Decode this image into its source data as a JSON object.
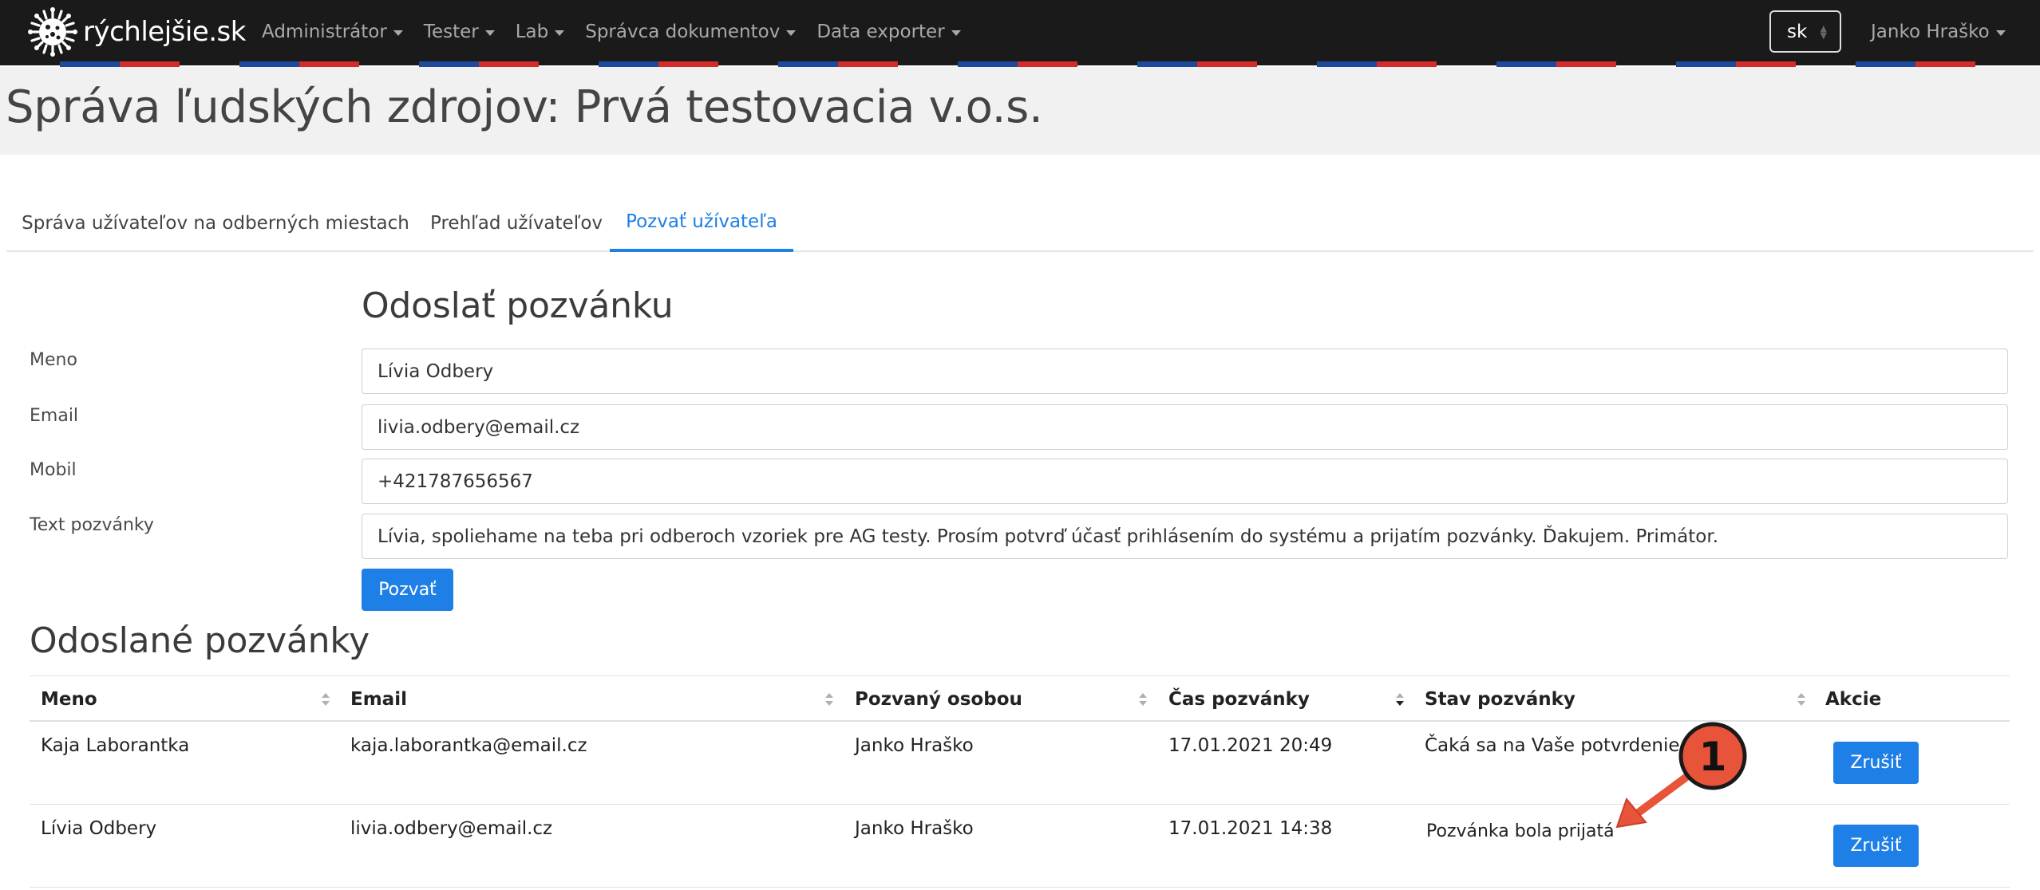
{
  "navbar": {
    "brand": "rýchlejšie.sk",
    "menu": [
      {
        "label": "Administrátor"
      },
      {
        "label": "Tester"
      },
      {
        "label": "Lab"
      },
      {
        "label": "Správca dokumentov"
      },
      {
        "label": "Data exporter"
      }
    ],
    "language": "sk",
    "user": "Janko Hraško"
  },
  "page": {
    "title": "Správa ľudských zdrojov: Prvá testovacia v.o.s."
  },
  "tabs": [
    {
      "label": "Správa užívateľov na odberných miestach",
      "active": false
    },
    {
      "label": "Prehľad užívateľov",
      "active": false
    },
    {
      "label": "Pozvať užívateľa",
      "active": true
    }
  ],
  "form": {
    "heading": "Odoslať pozvánku",
    "fields": {
      "name": {
        "label": "Meno",
        "value": "Lívia Odbery"
      },
      "email": {
        "label": "Email",
        "value": "livia.odbery@email.cz"
      },
      "mobile": {
        "label": "Mobil",
        "value": "+421787656567"
      },
      "text": {
        "label": "Text pozvánky",
        "value": "Lívia, spoliehame na teba pri odberoch vzoriek pre AG testy. Prosím potvrď účasť prihlásením do systému a prijatím pozvánky. Ďakujem. Primátor."
      }
    },
    "submit_label": "Pozvať"
  },
  "sent": {
    "heading": "Odoslané pozvánky",
    "columns": {
      "name": "Meno",
      "email": "Email",
      "invited_by": "Pozvaný osobou",
      "time": "Čas pozvánky",
      "status": "Stav pozvánky",
      "actions": "Akcie"
    },
    "rows": [
      {
        "name": "Kaja Laborantka",
        "email": "kaja.laborantka@email.cz",
        "invited_by": "Janko Hraško",
        "time": "17.01.2021 20:49",
        "status": "Čaká sa na Vaše potvrdenie",
        "action": "Zrušiť"
      },
      {
        "name": "Lívia Odbery",
        "email": "livia.odbery@email.cz",
        "invited_by": "Janko Hraško",
        "time": "17.01.2021 14:38",
        "status": "Pozvánka bola prijatá",
        "action": "Zrušiť"
      }
    ]
  },
  "annotation": {
    "marker": "1",
    "color": "#e8543a"
  },
  "colors": {
    "accent": "#1e7fe6",
    "navbar": "#1a1a1a",
    "flag_blue": "#1e4a9c",
    "flag_red": "#d42b2b"
  }
}
